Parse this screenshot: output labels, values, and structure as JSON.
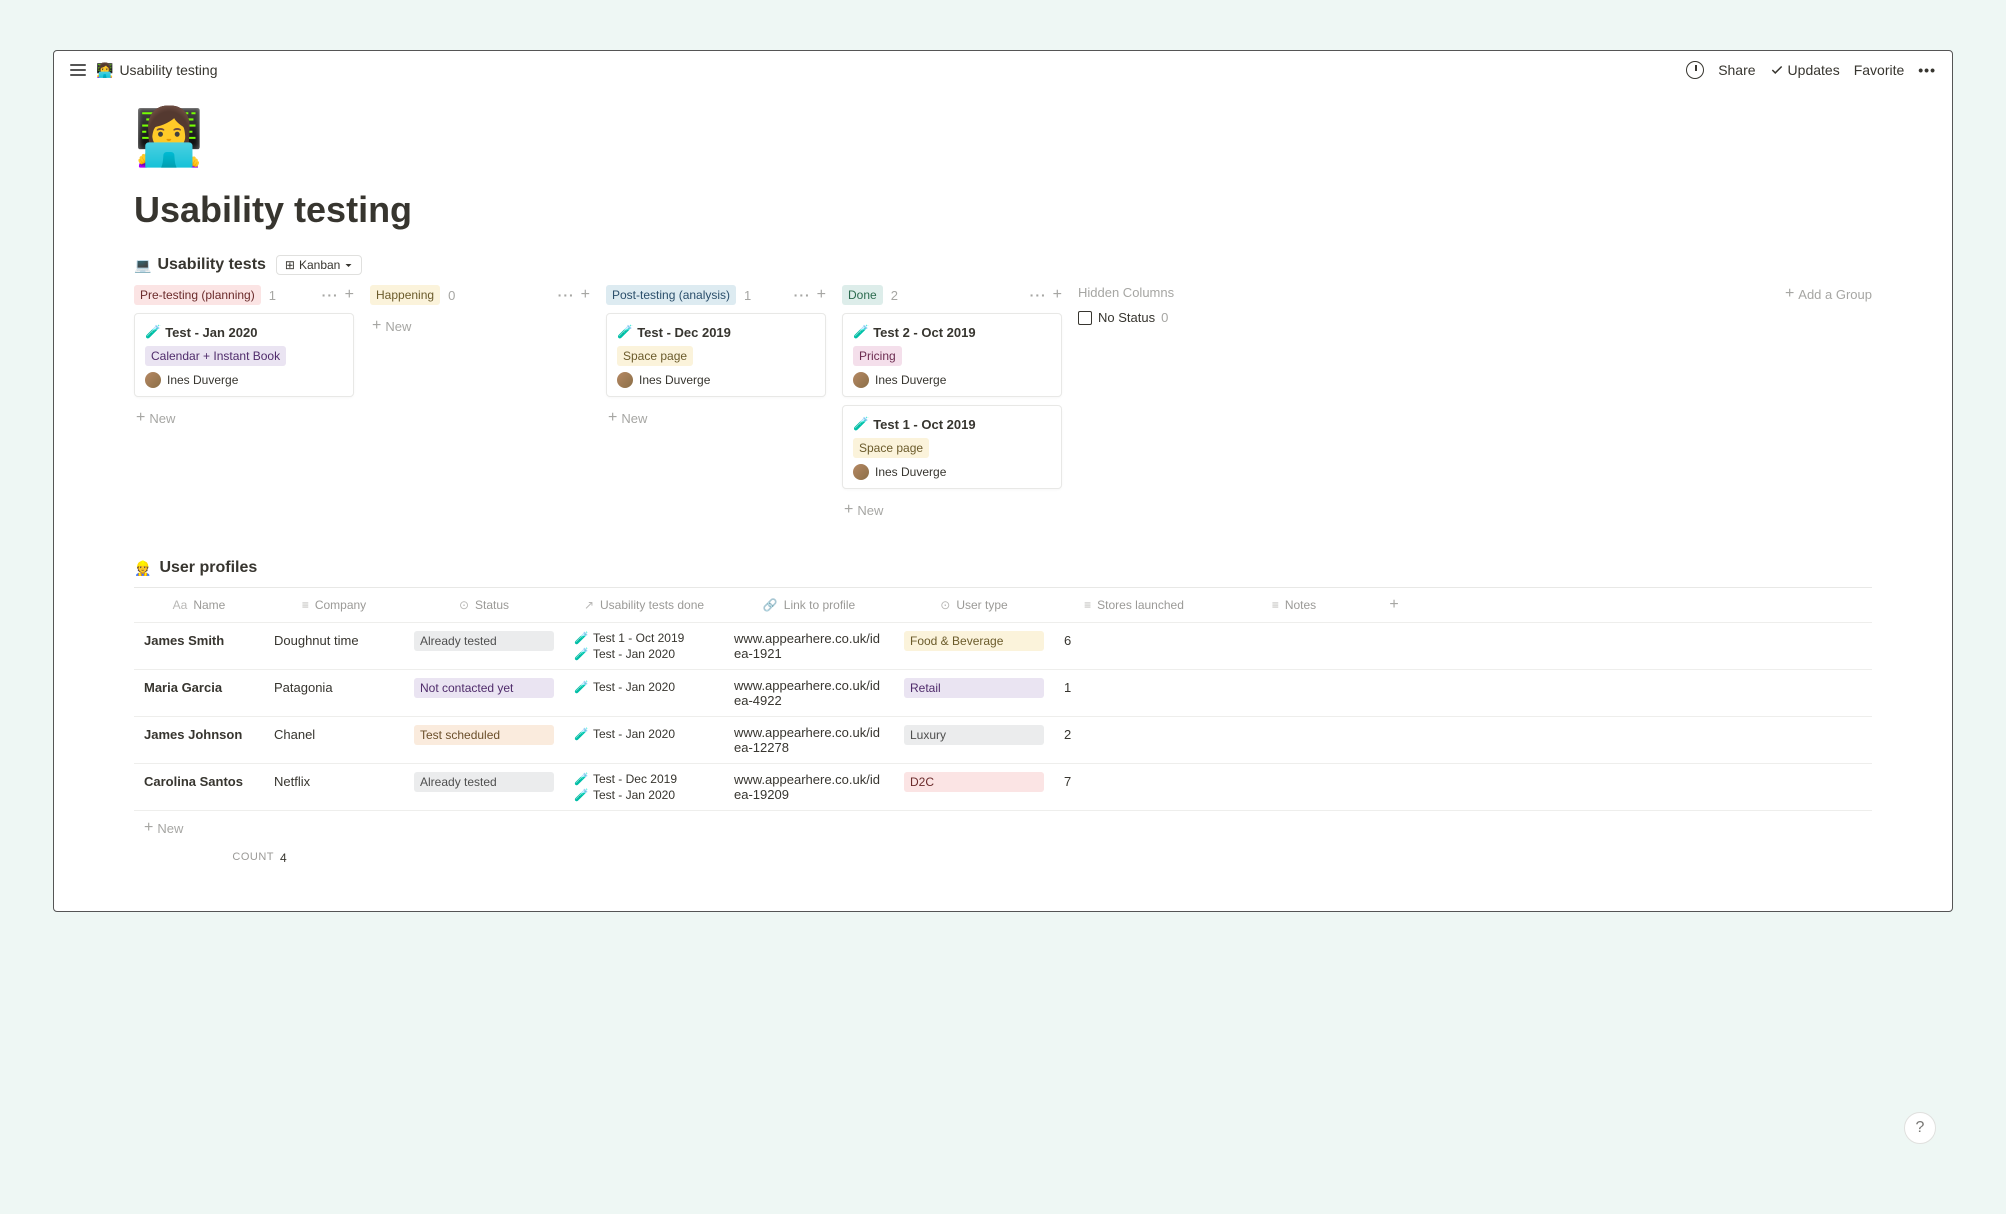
{
  "topbar": {
    "breadcrumb_emoji": "👩‍💻",
    "breadcrumb": "Usability testing",
    "share": "Share",
    "updates": "Updates",
    "favorite": "Favorite"
  },
  "page": {
    "icon": "👩‍💻",
    "title": "Usability testing"
  },
  "db1": {
    "icon": "💻",
    "title": "Usability tests",
    "view_icon": "⊞",
    "view_label": "Kanban",
    "columns": [
      {
        "name": "Pre-testing (planning)",
        "count": "1",
        "tag_class": "tag-red",
        "cards": [
          {
            "emoji": "🧪",
            "title": "Test - Jan 2020",
            "tag": "Calendar + Instant Book",
            "tag_class": "tag-purple",
            "assignee": "Ines Duverge"
          }
        ]
      },
      {
        "name": "Happening",
        "count": "0",
        "tag_class": "tag-yellow",
        "cards": []
      },
      {
        "name": "Post-testing (analysis)",
        "count": "1",
        "tag_class": "tag-blue",
        "cards": [
          {
            "emoji": "🧪",
            "title": "Test - Dec 2019",
            "tag": "Space page",
            "tag_class": "tag-yellow",
            "assignee": "Ines Duverge"
          }
        ]
      },
      {
        "name": "Done",
        "count": "2",
        "tag_class": "tag-green",
        "cards": [
          {
            "emoji": "🧪",
            "title": "Test 2 - Oct 2019",
            "tag": "Pricing",
            "tag_class": "tag-pink",
            "assignee": "Ines Duverge"
          },
          {
            "emoji": "🧪",
            "title": "Test 1 - Oct 2019",
            "tag": "Space page",
            "tag_class": "tag-yellow",
            "assignee": "Ines Duverge"
          }
        ]
      }
    ],
    "hidden_label": "Hidden Columns",
    "no_status_label": "No Status",
    "no_status_count": "0",
    "add_group": "Add a Group",
    "new_label": "New"
  },
  "db2": {
    "icon": "👷",
    "title": "User profiles",
    "columns": [
      {
        "icon": "Aa",
        "label": "Name"
      },
      {
        "icon": "≡",
        "label": "Company"
      },
      {
        "icon": "⊙",
        "label": "Status"
      },
      {
        "icon": "↗",
        "label": "Usability tests done"
      },
      {
        "icon": "🔗",
        "label": "Link to profile"
      },
      {
        "icon": "⊙",
        "label": "User type"
      },
      {
        "icon": "≡",
        "label": "Stores launched"
      },
      {
        "icon": "≡",
        "label": "Notes"
      }
    ],
    "rows": [
      {
        "name": "James Smith",
        "company": "Doughnut time",
        "status": "Already tested",
        "status_class": "tag-gray",
        "tests": [
          {
            "emoji": "🧪",
            "label": "Test 1 - Oct 2019"
          },
          {
            "emoji": "🧪",
            "label": "Test - Jan 2020"
          }
        ],
        "link": "www.appearhere.co.uk/idea-1921",
        "user_type": "Food & Beverage",
        "user_type_class": "tag-yellow",
        "stores": "6",
        "notes": ""
      },
      {
        "name": "Maria Garcia",
        "company": "Patagonia",
        "status": "Not contacted yet",
        "status_class": "tag-purple",
        "tests": [
          {
            "emoji": "🧪",
            "label": "Test - Jan 2020"
          }
        ],
        "link": "www.appearhere.co.uk/idea-4922",
        "user_type": "Retail",
        "user_type_class": "tag-purple",
        "stores": "1",
        "notes": ""
      },
      {
        "name": "James Johnson",
        "company": "Chanel",
        "status": "Test scheduled",
        "status_class": "tag-orange",
        "tests": [
          {
            "emoji": "🧪",
            "label": "Test - Jan 2020"
          }
        ],
        "link": "www.appearhere.co.uk/idea-12278",
        "user_type": "Luxury",
        "user_type_class": "tag-gray",
        "stores": "2",
        "notes": ""
      },
      {
        "name": "Carolina Santos",
        "company": "Netflix",
        "status": "Already tested",
        "status_class": "tag-gray",
        "tests": [
          {
            "emoji": "🧪",
            "label": "Test - Dec 2019"
          },
          {
            "emoji": "🧪",
            "label": "Test - Jan 2020"
          }
        ],
        "link": "www.appearhere.co.uk/idea-19209",
        "user_type": "D2C",
        "user_type_class": "tag-red",
        "stores": "7",
        "notes": ""
      }
    ],
    "new_label": "New",
    "count_label": "COUNT",
    "count_value": "4"
  },
  "help": "?"
}
